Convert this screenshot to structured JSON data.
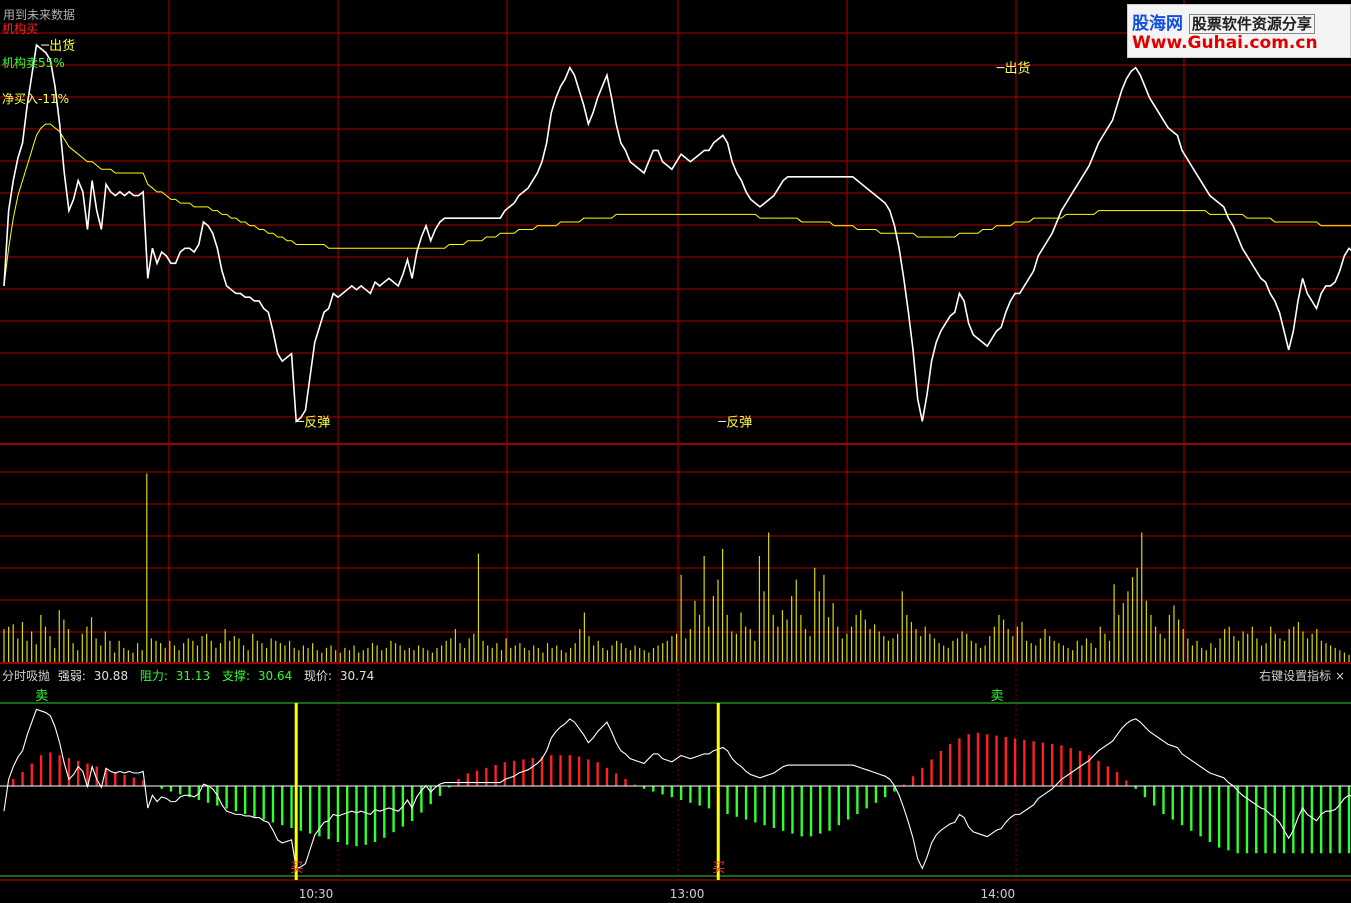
{
  "watermark": {
    "logo_text": "股海网",
    "tagline": "股票软件资源分享",
    "url": "Www.Guhai.com.cn"
  },
  "price_panel": {
    "top_note": "用到未来数据",
    "labels": [
      {
        "text": "机构买",
        "color": "#ff2020"
      },
      {
        "text": "机构卖55%",
        "color": "#30ff30"
      },
      {
        "text": "净买入-11%",
        "color": "#ffff40"
      }
    ],
    "annotations": [
      {
        "text": "出货",
        "x": 8,
        "y": 31.26,
        "color": "#ffff40"
      },
      {
        "text": "出货",
        "x": 214,
        "y": 31.2,
        "color": "#ffff40"
      },
      {
        "text": "反弹",
        "x": 63,
        "y": 30.26,
        "color": "#ffff40"
      },
      {
        "text": "反弹",
        "x": 154,
        "y": 30.26,
        "color": "#ffff40"
      }
    ]
  },
  "indicator_panel": {
    "name": "分时吸抛",
    "strength_label": "强弱:",
    "strength_value": "30.88",
    "resistance_label": "阻力:",
    "resistance_value": "31.13",
    "support_label": "支撑:",
    "support_value": "30.64",
    "price_label": "现价:",
    "price_value": "30.74",
    "hint": "右键设置指标 ×",
    "signals": [
      {
        "text": "卖",
        "x": 8,
        "color": "#30ff30"
      },
      {
        "text": "卖",
        "x": 214,
        "color": "#30ff30"
      },
      {
        "text": "买",
        "x": 63,
        "color": "#ff3030"
      },
      {
        "text": "买",
        "x": 154,
        "color": "#ff3030"
      }
    ]
  },
  "chart_data": {
    "type": "line",
    "x_ticks": [
      "10:30",
      "13:00",
      "14:00"
    ],
    "x_tick_index": [
      67,
      147,
      214
    ],
    "total_points": 291,
    "price_series": [
      30.62,
      30.82,
      30.9,
      30.96,
      31.0,
      31.1,
      31.18,
      31.26,
      31.25,
      31.24,
      31.22,
      31.15,
      31.05,
      30.92,
      30.82,
      30.85,
      30.9,
      30.87,
      30.77,
      30.9,
      30.82,
      30.77,
      30.89,
      30.87,
      30.86,
      30.87,
      30.86,
      30.87,
      30.86,
      30.86,
      30.87,
      30.64,
      30.72,
      30.68,
      30.71,
      30.7,
      30.68,
      30.68,
      30.71,
      30.72,
      30.72,
      30.71,
      30.73,
      30.79,
      30.78,
      30.76,
      30.72,
      30.66,
      30.62,
      30.61,
      30.6,
      30.6,
      30.59,
      30.59,
      30.58,
      30.58,
      30.56,
      30.55,
      30.5,
      30.44,
      30.42,
      30.43,
      30.44,
      30.26,
      30.27,
      30.29,
      30.38,
      30.47,
      30.51,
      30.55,
      30.56,
      30.6,
      30.59,
      30.6,
      30.61,
      30.62,
      30.61,
      30.62,
      30.61,
      30.6,
      30.63,
      30.62,
      30.63,
      30.64,
      30.63,
      30.62,
      30.65,
      30.69,
      30.64,
      30.71,
      30.75,
      30.78,
      30.74,
      30.77,
      30.79,
      30.8,
      30.8,
      30.8,
      30.8,
      30.8,
      30.8,
      30.8,
      30.8,
      30.8,
      30.8,
      30.8,
      30.8,
      30.8,
      30.82,
      30.83,
      30.84,
      30.86,
      30.87,
      30.88,
      30.9,
      30.92,
      30.95,
      31.0,
      31.08,
      31.12,
      31.15,
      31.17,
      31.2,
      31.18,
      31.14,
      31.1,
      31.05,
      31.08,
      31.12,
      31.15,
      31.18,
      31.12,
      31.05,
      31.0,
      30.98,
      30.95,
      30.94,
      30.93,
      30.92,
      30.95,
      30.98,
      30.98,
      30.95,
      30.94,
      30.93,
      30.95,
      30.97,
      30.96,
      30.95,
      30.96,
      30.97,
      30.98,
      30.98,
      31.0,
      31.01,
      31.02,
      31.0,
      30.95,
      30.92,
      30.9,
      30.87,
      30.85,
      30.84,
      30.83,
      30.84,
      30.85,
      30.86,
      30.88,
      30.9,
      30.91,
      30.91,
      30.91,
      30.91,
      30.91,
      30.91,
      30.91,
      30.91,
      30.91,
      30.91,
      30.91,
      30.91,
      30.91,
      30.91,
      30.91,
      30.9,
      30.89,
      30.88,
      30.87,
      30.86,
      30.85,
      30.84,
      30.82,
      30.78,
      30.72,
      30.64,
      30.55,
      30.45,
      30.32,
      30.26,
      30.33,
      30.42,
      30.47,
      30.5,
      30.52,
      30.54,
      30.55,
      30.6,
      30.58,
      30.52,
      30.49,
      30.48,
      30.47,
      30.46,
      30.48,
      30.5,
      30.51,
      30.55,
      30.58,
      30.6,
      30.6,
      30.62,
      30.64,
      30.66,
      30.7,
      30.72,
      30.74,
      30.76,
      30.79,
      30.82,
      30.84,
      30.86,
      30.88,
      30.9,
      30.92,
      30.94,
      30.97,
      31.0,
      31.02,
      31.04,
      31.06,
      31.1,
      31.14,
      31.17,
      31.19,
      31.2,
      31.18,
      31.15,
      31.12,
      31.1,
      31.08,
      31.06,
      31.04,
      31.03,
      31.02,
      30.98,
      30.96,
      30.94,
      30.92,
      30.9,
      30.88,
      30.86,
      30.85,
      30.84,
      30.83,
      30.8,
      30.78,
      30.75,
      30.72,
      30.7,
      30.68,
      30.66,
      30.64,
      30.63,
      30.6,
      30.58,
      30.55,
      30.5,
      30.45,
      30.5,
      30.58,
      30.64,
      30.6,
      30.58,
      30.56,
      30.6,
      30.62,
      30.62,
      30.63,
      30.66,
      30.7,
      30.72,
      30.71,
      30.7,
      30.68,
      30.68,
      30.7,
      30.72,
      30.73,
      30.74
    ],
    "avg_series": [
      30.62,
      30.72,
      30.8,
      30.86,
      30.9,
      30.94,
      30.98,
      31.02,
      31.04,
      31.05,
      31.05,
      31.04,
      31.03,
      31.01,
      30.99,
      30.98,
      30.97,
      30.96,
      30.95,
      30.95,
      30.94,
      30.93,
      30.93,
      30.93,
      30.92,
      30.92,
      30.92,
      30.92,
      30.92,
      30.92,
      30.92,
      30.89,
      30.88,
      30.87,
      30.87,
      30.86,
      30.85,
      30.85,
      30.84,
      30.84,
      30.84,
      30.83,
      30.83,
      30.83,
      30.83,
      30.82,
      30.82,
      30.81,
      30.81,
      30.8,
      30.8,
      30.79,
      30.79,
      30.78,
      30.78,
      30.77,
      30.77,
      30.76,
      30.76,
      30.75,
      30.75,
      30.74,
      30.74,
      30.73,
      30.73,
      30.73,
      30.73,
      30.73,
      30.73,
      30.73,
      30.72,
      30.72,
      30.72,
      30.72,
      30.72,
      30.72,
      30.72,
      30.72,
      30.72,
      30.72,
      30.72,
      30.72,
      30.72,
      30.72,
      30.72,
      30.72,
      30.72,
      30.72,
      30.72,
      30.72,
      30.72,
      30.72,
      30.72,
      30.72,
      30.72,
      30.72,
      30.73,
      30.73,
      30.73,
      30.73,
      30.74,
      30.74,
      30.74,
      30.74,
      30.75,
      30.75,
      30.75,
      30.76,
      30.76,
      30.76,
      30.76,
      30.77,
      30.77,
      30.77,
      30.77,
      30.78,
      30.78,
      30.78,
      30.78,
      30.78,
      30.79,
      30.79,
      30.79,
      30.79,
      30.79,
      30.8,
      30.8,
      30.8,
      30.8,
      30.8,
      30.8,
      30.8,
      30.81,
      30.81,
      30.81,
      30.81,
      30.81,
      30.81,
      30.81,
      30.81,
      30.81,
      30.81,
      30.81,
      30.81,
      30.81,
      30.81,
      30.81,
      30.81,
      30.81,
      30.81,
      30.81,
      30.81,
      30.81,
      30.81,
      30.81,
      30.81,
      30.81,
      30.81,
      30.81,
      30.81,
      30.81,
      30.81,
      30.81,
      30.8,
      30.8,
      30.8,
      30.8,
      30.8,
      30.8,
      30.8,
      30.8,
      30.8,
      30.79,
      30.79,
      30.79,
      30.79,
      30.79,
      30.79,
      30.79,
      30.78,
      30.78,
      30.78,
      30.78,
      30.78,
      30.77,
      30.77,
      30.77,
      30.77,
      30.77,
      30.76,
      30.76,
      30.76,
      30.76,
      30.76,
      30.76,
      30.76,
      30.76,
      30.75,
      30.75,
      30.75,
      30.75,
      30.75,
      30.75,
      30.75,
      30.75,
      30.75,
      30.76,
      30.76,
      30.76,
      30.76,
      30.76,
      30.77,
      30.77,
      30.77,
      30.78,
      30.78,
      30.78,
      30.78,
      30.79,
      30.79,
      30.79,
      30.79,
      30.8,
      30.8,
      30.8,
      30.8,
      30.8,
      30.8,
      30.8,
      30.81,
      30.81,
      30.81,
      30.81,
      30.81,
      30.81,
      30.81,
      30.82,
      30.82,
      30.82,
      30.82,
      30.82,
      30.82,
      30.82,
      30.82,
      30.82,
      30.82,
      30.82,
      30.82,
      30.82,
      30.82,
      30.82,
      30.82,
      30.82,
      30.82,
      30.82,
      30.82,
      30.82,
      30.82,
      30.82,
      30.82,
      30.81,
      30.81,
      30.81,
      30.81,
      30.81,
      30.81,
      30.81,
      30.81,
      30.8,
      30.8,
      30.8,
      30.8,
      30.8,
      30.8,
      30.79,
      30.79,
      30.79,
      30.79,
      30.79,
      30.79,
      30.79,
      30.79,
      30.79,
      30.79,
      30.78,
      30.78,
      30.78,
      30.78,
      30.78,
      30.78,
      30.78,
      30.78,
      30.78,
      30.77,
      30.77,
      30.77,
      30.77,
      30.77,
      30.77,
      30.77,
      30.77
    ],
    "volume": [
      28,
      30,
      32,
      20,
      34,
      18,
      26,
      15,
      40,
      30,
      22,
      12,
      44,
      36,
      28,
      16,
      10,
      24,
      30,
      38,
      20,
      14,
      26,
      18,
      8,
      18,
      12,
      10,
      8,
      16,
      10,
      160,
      20,
      18,
      16,
      12,
      18,
      14,
      10,
      16,
      20,
      18,
      14,
      22,
      24,
      18,
      12,
      16,
      28,
      18,
      22,
      20,
      14,
      10,
      24,
      18,
      16,
      12,
      20,
      18,
      16,
      14,
      18,
      12,
      10,
      14,
      12,
      16,
      10,
      8,
      12,
      14,
      10,
      8,
      12,
      10,
      14,
      8,
      10,
      12,
      16,
      14,
      10,
      12,
      18,
      16,
      14,
      10,
      12,
      10,
      14,
      12,
      10,
      8,
      12,
      14,
      18,
      20,
      28,
      16,
      12,
      20,
      24,
      92,
      18,
      14,
      12,
      16,
      10,
      20,
      12,
      14,
      16,
      12,
      10,
      14,
      12,
      8,
      16,
      12,
      14,
      10,
      8,
      12,
      16,
      28,
      42,
      22,
      14,
      18,
      12,
      10,
      14,
      18,
      16,
      12,
      10,
      14,
      12,
      10,
      8,
      12,
      14,
      16,
      18,
      22,
      24,
      74,
      20,
      28,
      52,
      40,
      90,
      30,
      56,
      70,
      96,
      40,
      26,
      24,
      42,
      30,
      28,
      18,
      90,
      60,
      110,
      40,
      30,
      44,
      36,
      56,
      70,
      40,
      28,
      22,
      80,
      60,
      74,
      38,
      50,
      30,
      20,
      24,
      30,
      40,
      44,
      36,
      28,
      32,
      26,
      22,
      18,
      20,
      24,
      60,
      40,
      34,
      28,
      22,
      30,
      24,
      20,
      16,
      14,
      12,
      18,
      20,
      26,
      24,
      18,
      16,
      12,
      14,
      22,
      30,
      40,
      36,
      28,
      22,
      30,
      34,
      18,
      16,
      14,
      20,
      28,
      22,
      18,
      16,
      14,
      12,
      10,
      18,
      14,
      20,
      16,
      12,
      30,
      24,
      18,
      66,
      40,
      50,
      60,
      72,
      80,
      110,
      52,
      40,
      30,
      24,
      20,
      40,
      48,
      36,
      28,
      20,
      14,
      18,
      12,
      10,
      16,
      12,
      20,
      28,
      30,
      22,
      18,
      26,
      24,
      30,
      20,
      14,
      16,
      30,
      24,
      20,
      18,
      28,
      30,
      34,
      26,
      20,
      24,
      28,
      18,
      16,
      14,
      12,
      10,
      8,
      6
    ],
    "ylim_price": [
      30.2,
      31.3
    ],
    "osc_series": [
      0,
      0.02,
      0.05,
      0.08,
      0.1,
      0.13,
      0.16,
      0.19,
      0.22,
      0.24,
      0.24,
      0.23,
      0.22,
      0.21,
      0.2,
      0.19,
      0.18,
      0.17,
      0.16,
      0.15,
      0.14,
      0.13,
      0.12,
      0.11,
      0.1,
      0.09,
      0.08,
      0.07,
      0.06,
      0.05,
      0.04,
      0.02,
      0.0,
      -0.01,
      -0.02,
      -0.03,
      -0.04,
      -0.05,
      -0.06,
      -0.07,
      -0.08,
      -0.09,
      -0.1,
      -0.11,
      -0.12,
      -0.13,
      -0.14,
      -0.15,
      -0.16,
      -0.17,
      -0.18,
      -0.19,
      -0.2,
      -0.21,
      -0.22,
      -0.23,
      -0.24,
      -0.25,
      -0.26,
      -0.27,
      -0.28,
      -0.29,
      -0.3,
      -0.31,
      -0.32,
      -0.33,
      -0.34,
      -0.35,
      -0.36,
      -0.37,
      -0.38,
      -0.39,
      -0.4,
      -0.41,
      -0.42,
      -0.42,
      -0.43,
      -0.43,
      -0.42,
      -0.41,
      -0.4,
      -0.39,
      -0.37,
      -0.35,
      -0.33,
      -0.31,
      -0.29,
      -0.27,
      -0.25,
      -0.22,
      -0.19,
      -0.16,
      -0.13,
      -0.1,
      -0.07,
      -0.04,
      -0.01,
      0.02,
      0.05,
      0.07,
      0.09,
      0.1,
      0.11,
      0.12,
      0.13,
      0.14,
      0.15,
      0.16,
      0.17,
      0.17,
      0.18,
      0.18,
      0.19,
      0.19,
      0.2,
      0.2,
      0.21,
      0.21,
      0.22,
      0.22,
      0.22,
      0.22,
      0.22,
      0.22,
      0.21,
      0.2,
      0.19,
      0.18,
      0.17,
      0.15,
      0.13,
      0.11,
      0.09,
      0.07,
      0.05,
      0.03,
      0.01,
      -0.01,
      -0.02,
      -0.03,
      -0.04,
      -0.05,
      -0.06,
      -0.07,
      -0.08,
      -0.09,
      -0.1,
      -0.11,
      -0.12,
      -0.13,
      -0.14,
      -0.15,
      -0.16,
      -0.17,
      -0.18,
      -0.19,
      -0.2,
      -0.21,
      -0.22,
      -0.23,
      -0.24,
      -0.25,
      -0.26,
      -0.27,
      -0.28,
      -0.29,
      -0.3,
      -0.31,
      -0.32,
      -0.33,
      -0.34,
      -0.35,
      -0.36,
      -0.36,
      -0.36,
      -0.35,
      -0.34,
      -0.33,
      -0.32,
      -0.3,
      -0.28,
      -0.26,
      -0.24,
      -0.22,
      -0.2,
      -0.18,
      -0.16,
      -0.14,
      -0.12,
      -0.1,
      -0.08,
      -0.06,
      -0.04,
      -0.02,
      0.01,
      0.04,
      0.07,
      0.1,
      0.13,
      0.16,
      0.19,
      0.22,
      0.25,
      0.28,
      0.3,
      0.32,
      0.34,
      0.36,
      0.37,
      0.38,
      0.38,
      0.38,
      0.37,
      0.37,
      0.36,
      0.36,
      0.35,
      0.35,
      0.34,
      0.34,
      0.33,
      0.33,
      0.32,
      0.32,
      0.31,
      0.31,
      0.3,
      0.3,
      0.29,
      0.28,
      0.27,
      0.26,
      0.25,
      0.24,
      0.22,
      0.2,
      0.18,
      0.16,
      0.14,
      0.12,
      0.1,
      0.07,
      0.04,
      0.01,
      -0.02,
      -0.05,
      -0.08,
      -0.11,
      -0.14,
      -0.17,
      -0.2,
      -0.22,
      -0.24,
      -0.26,
      -0.28,
      -0.3,
      -0.32,
      -0.34,
      -0.36,
      -0.38,
      -0.4,
      -0.42,
      -0.44,
      -0.45,
      -0.46,
      -0.47,
      -0.48,
      -0.48,
      -0.48,
      -0.48,
      -0.48,
      -0.48,
      -0.48,
      -0.48,
      -0.48,
      -0.48,
      -0.48,
      -0.48,
      -0.48,
      -0.48,
      -0.48,
      -0.48,
      -0.48,
      -0.48,
      -0.48,
      -0.48,
      -0.48,
      -0.48,
      -0.48,
      -0.48,
      -0.48,
      -0.48,
      -0.48,
      -0.48,
      -0.48,
      -0.48
    ],
    "resistance": 31.13,
    "support": 30.64,
    "colors": {
      "up": "#ff2020",
      "down": "#30ff30",
      "price": "#ffffff",
      "avg": "#ffff00",
      "grid": "#b00000",
      "volume": "#d8d800",
      "resistance": "#30d030"
    }
  }
}
